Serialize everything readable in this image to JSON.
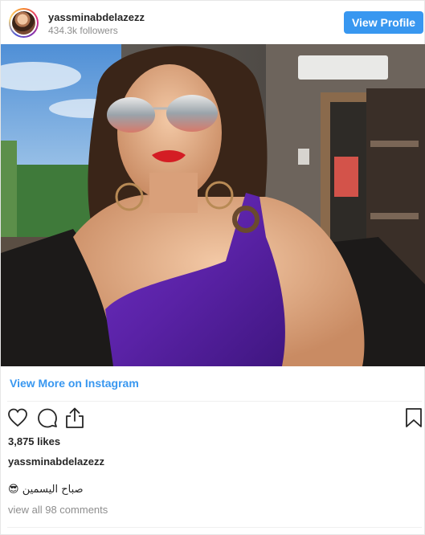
{
  "header": {
    "username": "yassminabdelazezz",
    "followers": "434.3k followers",
    "view_profile_label": "View Profile"
  },
  "post": {
    "view_more_label": "View More on Instagram",
    "likes": "3,875 likes",
    "caption_username": "yassminabdelazezz",
    "caption_text": "😎 صباح اليسمين",
    "view_comments": "view all 98 comments"
  },
  "icons": {
    "like": "heart-icon",
    "comment": "comment-icon",
    "share": "share-icon",
    "save": "bookmark-icon"
  },
  "colors": {
    "accent": "#3897f0",
    "text": "#262626",
    "muted": "#8e8e8e"
  }
}
